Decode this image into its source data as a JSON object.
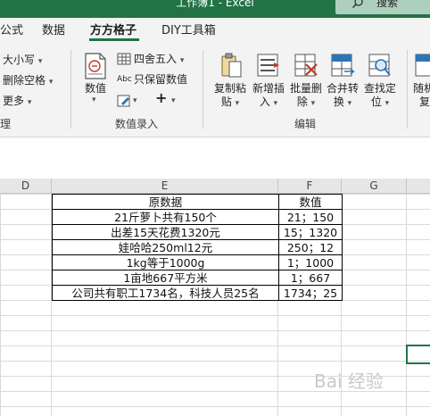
{
  "window": {
    "title": "工作簿1 - Excel"
  },
  "search": {
    "label": "搜索"
  },
  "tabs": [
    "公式",
    "数据",
    "方方格子",
    "DIY工具箱"
  ],
  "active_tab": "方方格子",
  "ribbon": {
    "left_group": {
      "case": "大小写",
      "delete_space": "删除空格",
      "more": "更多",
      "group_label": "理"
    },
    "value_group": {
      "value_button": "数值",
      "round": "四舍五入",
      "keep_values": "只保留数值",
      "group_label": "数值录入"
    },
    "edit_group": {
      "copy_paste": [
        "复制粘",
        "贴"
      ],
      "add_insert": [
        "新增插",
        "入"
      ],
      "batch_delete": [
        "批量删",
        "除"
      ],
      "merge_convert": [
        "合并转",
        "换"
      ],
      "find_locate": [
        "查找定",
        "位"
      ],
      "random": [
        "随机",
        "复"
      ],
      "group_label": "编辑"
    }
  },
  "columns": [
    "D",
    "E",
    "F",
    "G"
  ],
  "table": {
    "headers": [
      "原数据",
      "数值"
    ],
    "rows": [
      [
        "21斤萝卜共有150个",
        "21；150"
      ],
      [
        "出差15天花费1320元",
        "15；1320"
      ],
      [
        "娃哈哈250ml12元",
        "250；12"
      ],
      [
        "1kg等于1000g",
        "1；1000"
      ],
      [
        "1亩地667平方米",
        "1；667"
      ],
      [
        "公司共有职工1734名，科技人员25名",
        "1734；25"
      ]
    ]
  },
  "watermark": "Bai 经验"
}
